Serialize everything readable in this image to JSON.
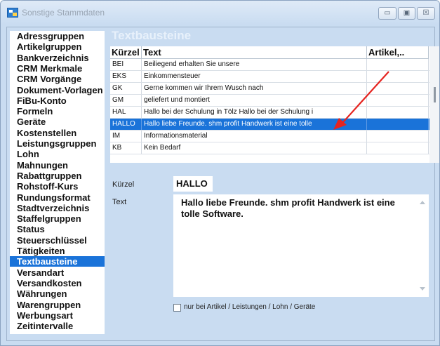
{
  "window": {
    "title": "Sonstige Stammdaten",
    "min_glyph": "▭",
    "max_glyph": "▣",
    "close_glyph": "☒"
  },
  "sidebar": {
    "items": [
      {
        "label": "Adressgruppen"
      },
      {
        "label": "Artikelgruppen"
      },
      {
        "label": "Bankverzeichnis"
      },
      {
        "label": "CRM Merkmale"
      },
      {
        "label": "CRM Vorgänge"
      },
      {
        "label": "Dokument-Vorlagen"
      },
      {
        "label": "FiBu-Konto"
      },
      {
        "label": "Formeln"
      },
      {
        "label": "Geräte"
      },
      {
        "label": "Kostenstellen"
      },
      {
        "label": "Leistungsgruppen"
      },
      {
        "label": "Lohn"
      },
      {
        "label": "Mahnungen"
      },
      {
        "label": "Rabattgruppen"
      },
      {
        "label": "Rohstoff-Kurs"
      },
      {
        "label": "Rundungsformat"
      },
      {
        "label": "Stadtverzeichnis"
      },
      {
        "label": "Staffelgruppen"
      },
      {
        "label": "Status"
      },
      {
        "label": "Steuerschlüssel"
      },
      {
        "label": "Tätigkeiten"
      },
      {
        "label": "Textbausteine",
        "selected": true
      },
      {
        "label": "Versandart"
      },
      {
        "label": "Versandkosten"
      },
      {
        "label": "Währungen"
      },
      {
        "label": "Warengruppen"
      },
      {
        "label": "Werbungsart"
      },
      {
        "label": "Zeitintervalle"
      }
    ]
  },
  "panel": {
    "title": "Textbausteine",
    "table": {
      "columns": [
        "Kürzel",
        "Text",
        "Artikel,.."
      ],
      "rows": [
        {
          "kurzel": "BEI",
          "text": "Beiliegend erhalten Sie unsere",
          "artikel": ""
        },
        {
          "kurzel": "EKS",
          "text": "Einkommensteuer",
          "artikel": ""
        },
        {
          "kurzel": "GK",
          "text": "Gerne kommen wir Ihrem Wusch nach",
          "artikel": ""
        },
        {
          "kurzel": "GM",
          "text": "geliefert und montiert",
          "artikel": ""
        },
        {
          "kurzel": "HAL",
          "text": "Hallo bei der Schulung in Tölz Hallo bei der Schulung i",
          "artikel": ""
        },
        {
          "kurzel": "HALLO",
          "text": "Hallo liebe Freunde. shm profit Handwerk ist eine tolle",
          "artikel": "",
          "selected": true
        },
        {
          "kurzel": "IM",
          "text": "Informationsmaterial",
          "artikel": ""
        },
        {
          "kurzel": "KB",
          "text": "Kein Bedarf",
          "artikel": ""
        }
      ]
    },
    "detail": {
      "kurzel_label": "Kürzel",
      "kurzel_value": "HALLO",
      "text_label": "Text",
      "text_value": "Hallo liebe Freunde. shm profit Handwerk ist eine tolle Software.",
      "checkbox_label": "nur bei Artikel / Leistungen / Lohn / Geräte"
    }
  },
  "annotation": {
    "color": "#e52420"
  }
}
